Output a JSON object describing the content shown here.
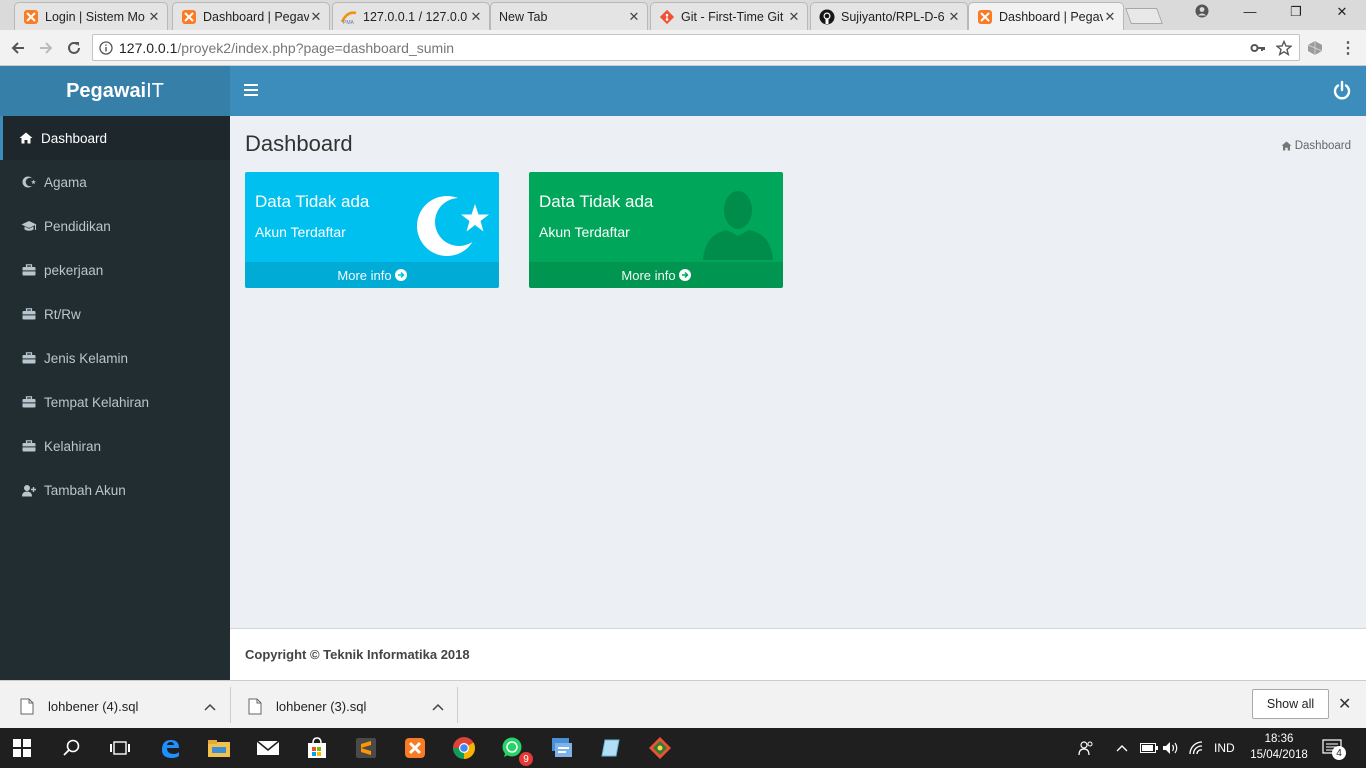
{
  "browser": {
    "tabs": [
      {
        "title": "Login | Sistem Mo",
        "favicon": "xampp-icon",
        "active": false
      },
      {
        "title": "Dashboard | Pegav",
        "favicon": "xampp-icon",
        "active": false
      },
      {
        "title": "127.0.0.1 / 127.0.0",
        "favicon": "phpmyadmin-icon",
        "active": false
      },
      {
        "title": "New Tab",
        "favicon": "",
        "active": false
      },
      {
        "title": "Git - First-Time Git",
        "favicon": "git-icon",
        "active": false
      },
      {
        "title": "Sujiyanto/RPL-D-6",
        "favicon": "github-icon",
        "active": false
      },
      {
        "title": "Dashboard | Pegav",
        "favicon": "xampp-icon",
        "active": true
      }
    ],
    "address": {
      "host": "127.0.0.1",
      "path": "/proyek2/index.php?page=dashboard_sumin"
    }
  },
  "app": {
    "brand_bold": "Pegawai",
    "brand_light": "IT",
    "sidebar": {
      "items": [
        {
          "label": "Dashboard",
          "icon": "home-icon",
          "active": true
        },
        {
          "label": "Agama",
          "icon": "moon-star-icon",
          "active": false
        },
        {
          "label": "Pendidikan",
          "icon": "graduation-cap-icon",
          "active": false
        },
        {
          "label": "pekerjaan",
          "icon": "briefcase-icon",
          "active": false
        },
        {
          "label": "Rt/Rw",
          "icon": "briefcase-icon",
          "active": false
        },
        {
          "label": "Jenis Kelamin",
          "icon": "briefcase-icon",
          "active": false
        },
        {
          "label": "Tempat Kelahiran",
          "icon": "briefcase-icon",
          "active": false
        },
        {
          "label": "Kelahiran",
          "icon": "briefcase-icon",
          "active": false
        },
        {
          "label": "Tambah Akun",
          "icon": "user-plus-icon",
          "active": false
        }
      ]
    },
    "page_title": "Dashboard",
    "breadcrumb": "Dashboard",
    "boxes": [
      {
        "title": "Data Tidak ada",
        "subtitle": "Akun Terdaftar",
        "footer": "More info",
        "color": "#00c0ef",
        "icon": "moon-star-icon"
      },
      {
        "title": "Data Tidak ada",
        "subtitle": "Akun Terdaftar",
        "footer": "More info",
        "color": "#00a65a",
        "icon": "user-icon"
      }
    ],
    "footer": "Copyright © Teknik Informatika 2018"
  },
  "downloads": {
    "items": [
      {
        "name": "lohbener (4).sql"
      },
      {
        "name": "lohbener (3).sql"
      }
    ],
    "show_all": "Show all"
  },
  "taskbar": {
    "language": "IND",
    "time": "18:36",
    "date": "15/04/2018",
    "notification_count": "4",
    "whatsapp_badge": "9"
  }
}
